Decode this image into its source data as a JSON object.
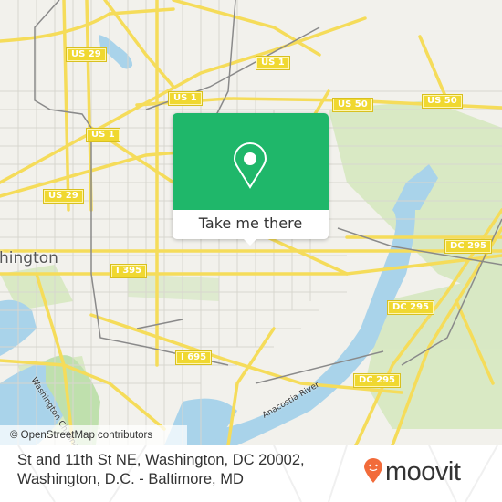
{
  "map": {
    "city_label": "hington",
    "river_labels": {
      "washington_channel": "Washington Channel",
      "anacostia": "Anacostia River"
    },
    "shields": [
      {
        "id": "us29-top",
        "label": "US 29"
      },
      {
        "id": "us1-top",
        "label": "US 1"
      },
      {
        "id": "us1-mid",
        "label": "US 1"
      },
      {
        "id": "us1-left",
        "label": "US 1"
      },
      {
        "id": "us50-left",
        "label": "US 50"
      },
      {
        "id": "us50-right",
        "label": "US 50"
      },
      {
        "id": "us29-left",
        "label": "US 29"
      },
      {
        "id": "i395",
        "label": "I 395"
      },
      {
        "id": "i695",
        "label": "I 695"
      },
      {
        "id": "dc295-top",
        "label": "DC 295"
      },
      {
        "id": "dc295-mid",
        "label": "DC 295"
      },
      {
        "id": "dc295-bottom",
        "label": "DC 295"
      }
    ],
    "attribution": "© OpenStreetMap contributors"
  },
  "popup": {
    "icon": "map-pin-icon",
    "button_label": "Take me there",
    "color": "#1fb76a"
  },
  "footer": {
    "address_line1": "St and 11th St NE, Washington, DC 20002,",
    "address_line2": "Washington, D.C. - Baltimore, MD",
    "logo_text": "moovit",
    "logo_color": "#f26b3a"
  }
}
